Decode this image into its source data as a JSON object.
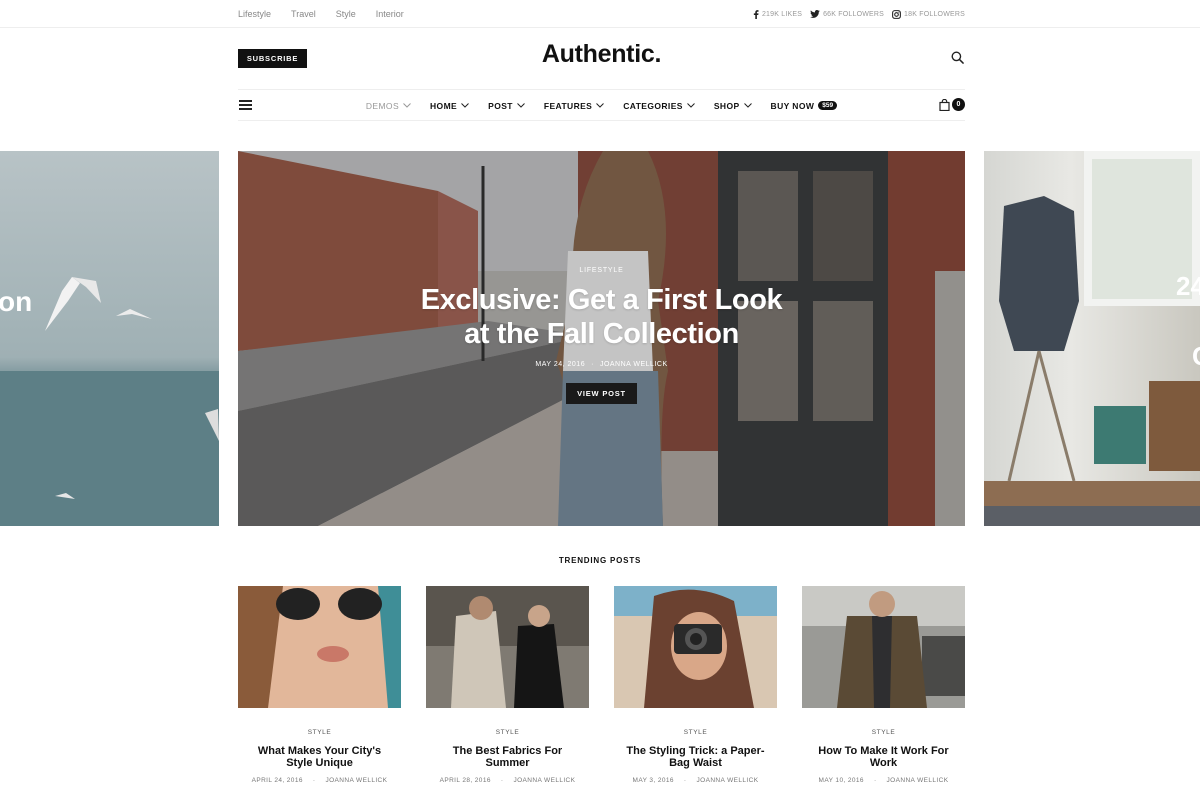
{
  "topbar": {
    "links": [
      "Lifestyle",
      "Travel",
      "Style",
      "Interior"
    ],
    "social": {
      "facebook": "219K LIKES",
      "twitter": "66K FOLLOWERS",
      "instagram": "18K FOLLOWERS"
    }
  },
  "header": {
    "subscribe_label": "SUBSCRIBE",
    "logo": "Authentic."
  },
  "nav": {
    "items": [
      {
        "label": "DEMOS",
        "dropdown": true
      },
      {
        "label": "HOME",
        "dropdown": true
      },
      {
        "label": "POST",
        "dropdown": true
      },
      {
        "label": "FEATURES",
        "dropdown": true
      },
      {
        "label": "CATEGORIES",
        "dropdown": true
      },
      {
        "label": "SHOP",
        "dropdown": true
      },
      {
        "label": "BUY NOW",
        "dropdown": false
      }
    ],
    "buy_price": "$59",
    "cart_count": "0"
  },
  "slider": {
    "left_partial_text": "on",
    "right_partial_text": "24",
    "right_partial_text_2": "C",
    "featured": {
      "category": "LIFESTYLE",
      "title_line1": "Exclusive: Get a First Look",
      "title_line2": "at the Fall Collection",
      "date": "MAY 24, 2016",
      "author": "JOANNA WELLICK",
      "button_label": "VIEW POST"
    }
  },
  "trending": {
    "section_title": "TRENDING POSTS",
    "posts": [
      {
        "category": "STYLE",
        "title": "What Makes Your City's Style Unique",
        "date": "APRIL 24, 2016",
        "author": "JOANNA WELLICK"
      },
      {
        "category": "STYLE",
        "title": "The Best Fabrics For Summer",
        "date": "APRIL 28, 2016",
        "author": "JOANNA WELLICK"
      },
      {
        "category": "STYLE",
        "title": "The Styling Trick: a Paper-Bag Waist",
        "date": "MAY 3, 2016",
        "author": "JOANNA WELLICK"
      },
      {
        "category": "STYLE",
        "title": "How To Make It Work For Work",
        "date": "MAY 10, 2016",
        "author": "JOANNA WELLICK"
      }
    ]
  },
  "colors": {
    "text": "#111111",
    "muted": "#999999",
    "button_bg": "#111111"
  }
}
